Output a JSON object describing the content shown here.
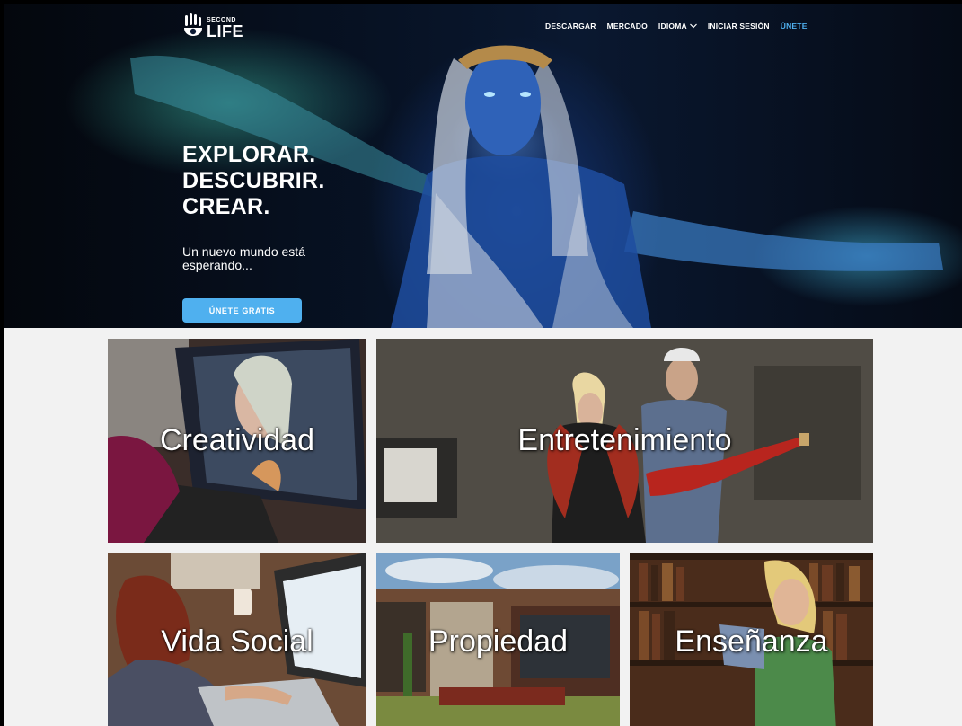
{
  "brand": {
    "second": "SECOND",
    "life": "LIFE"
  },
  "nav": {
    "items": [
      {
        "label": "DESCARGAR"
      },
      {
        "label": "MERCADO"
      },
      {
        "label": "IDIOMA"
      },
      {
        "label": "INICIAR SESIÓN"
      },
      {
        "label": "ÚNETE"
      }
    ]
  },
  "hero": {
    "headline": [
      "EXPLORAR.",
      "DESCUBRIR.",
      "CREAR."
    ],
    "subline": "Un nuevo mundo está esperando...",
    "cta": "ÚNETE GRATIS"
  },
  "tiles": [
    {
      "label": "Creatividad"
    },
    {
      "label": "Entretenimiento"
    },
    {
      "label": "Vida Social"
    },
    {
      "label": "Propiedad"
    },
    {
      "label": "Enseñanza"
    }
  ],
  "colors": {
    "accent": "#4fb0ef",
    "page_bg": "#f2f2f2",
    "hero_bg": "#071224"
  }
}
